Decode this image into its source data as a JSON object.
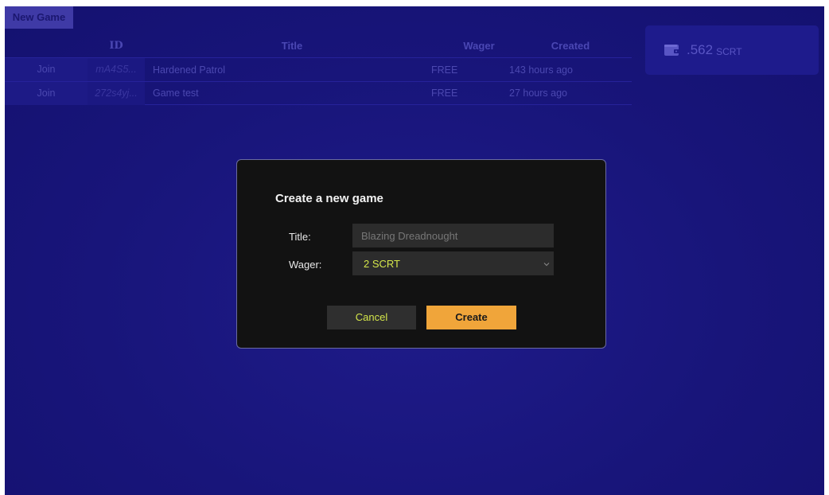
{
  "toolbar": {
    "new_game_label": "New Game"
  },
  "table": {
    "headers": {
      "id": "ID",
      "title": "Title",
      "wager": "Wager",
      "created": "Created"
    },
    "rows": [
      {
        "join": "Join",
        "id": "mA4S5...",
        "title": "Hardened Patrol",
        "wager": "FREE",
        "created": "143 hours ago"
      },
      {
        "join": "Join",
        "id": "272s4yj...",
        "title": "Game test",
        "wager": "FREE",
        "created": "27 hours ago"
      }
    ]
  },
  "wallet": {
    "icon": "wallet-icon",
    "balance": ".562",
    "unit": "SCRT"
  },
  "modal": {
    "title": "Create a new game",
    "title_label": "Title:",
    "title_placeholder": "Blazing Dreadnought",
    "wager_label": "Wager:",
    "wager_value": "2 SCRT",
    "cancel_label": "Cancel",
    "create_label": "Create"
  },
  "colors": {
    "background": "#18157a",
    "modal_bg": "#121212",
    "accent": "#f0a53a",
    "highlight_text": "#d4e64a"
  }
}
